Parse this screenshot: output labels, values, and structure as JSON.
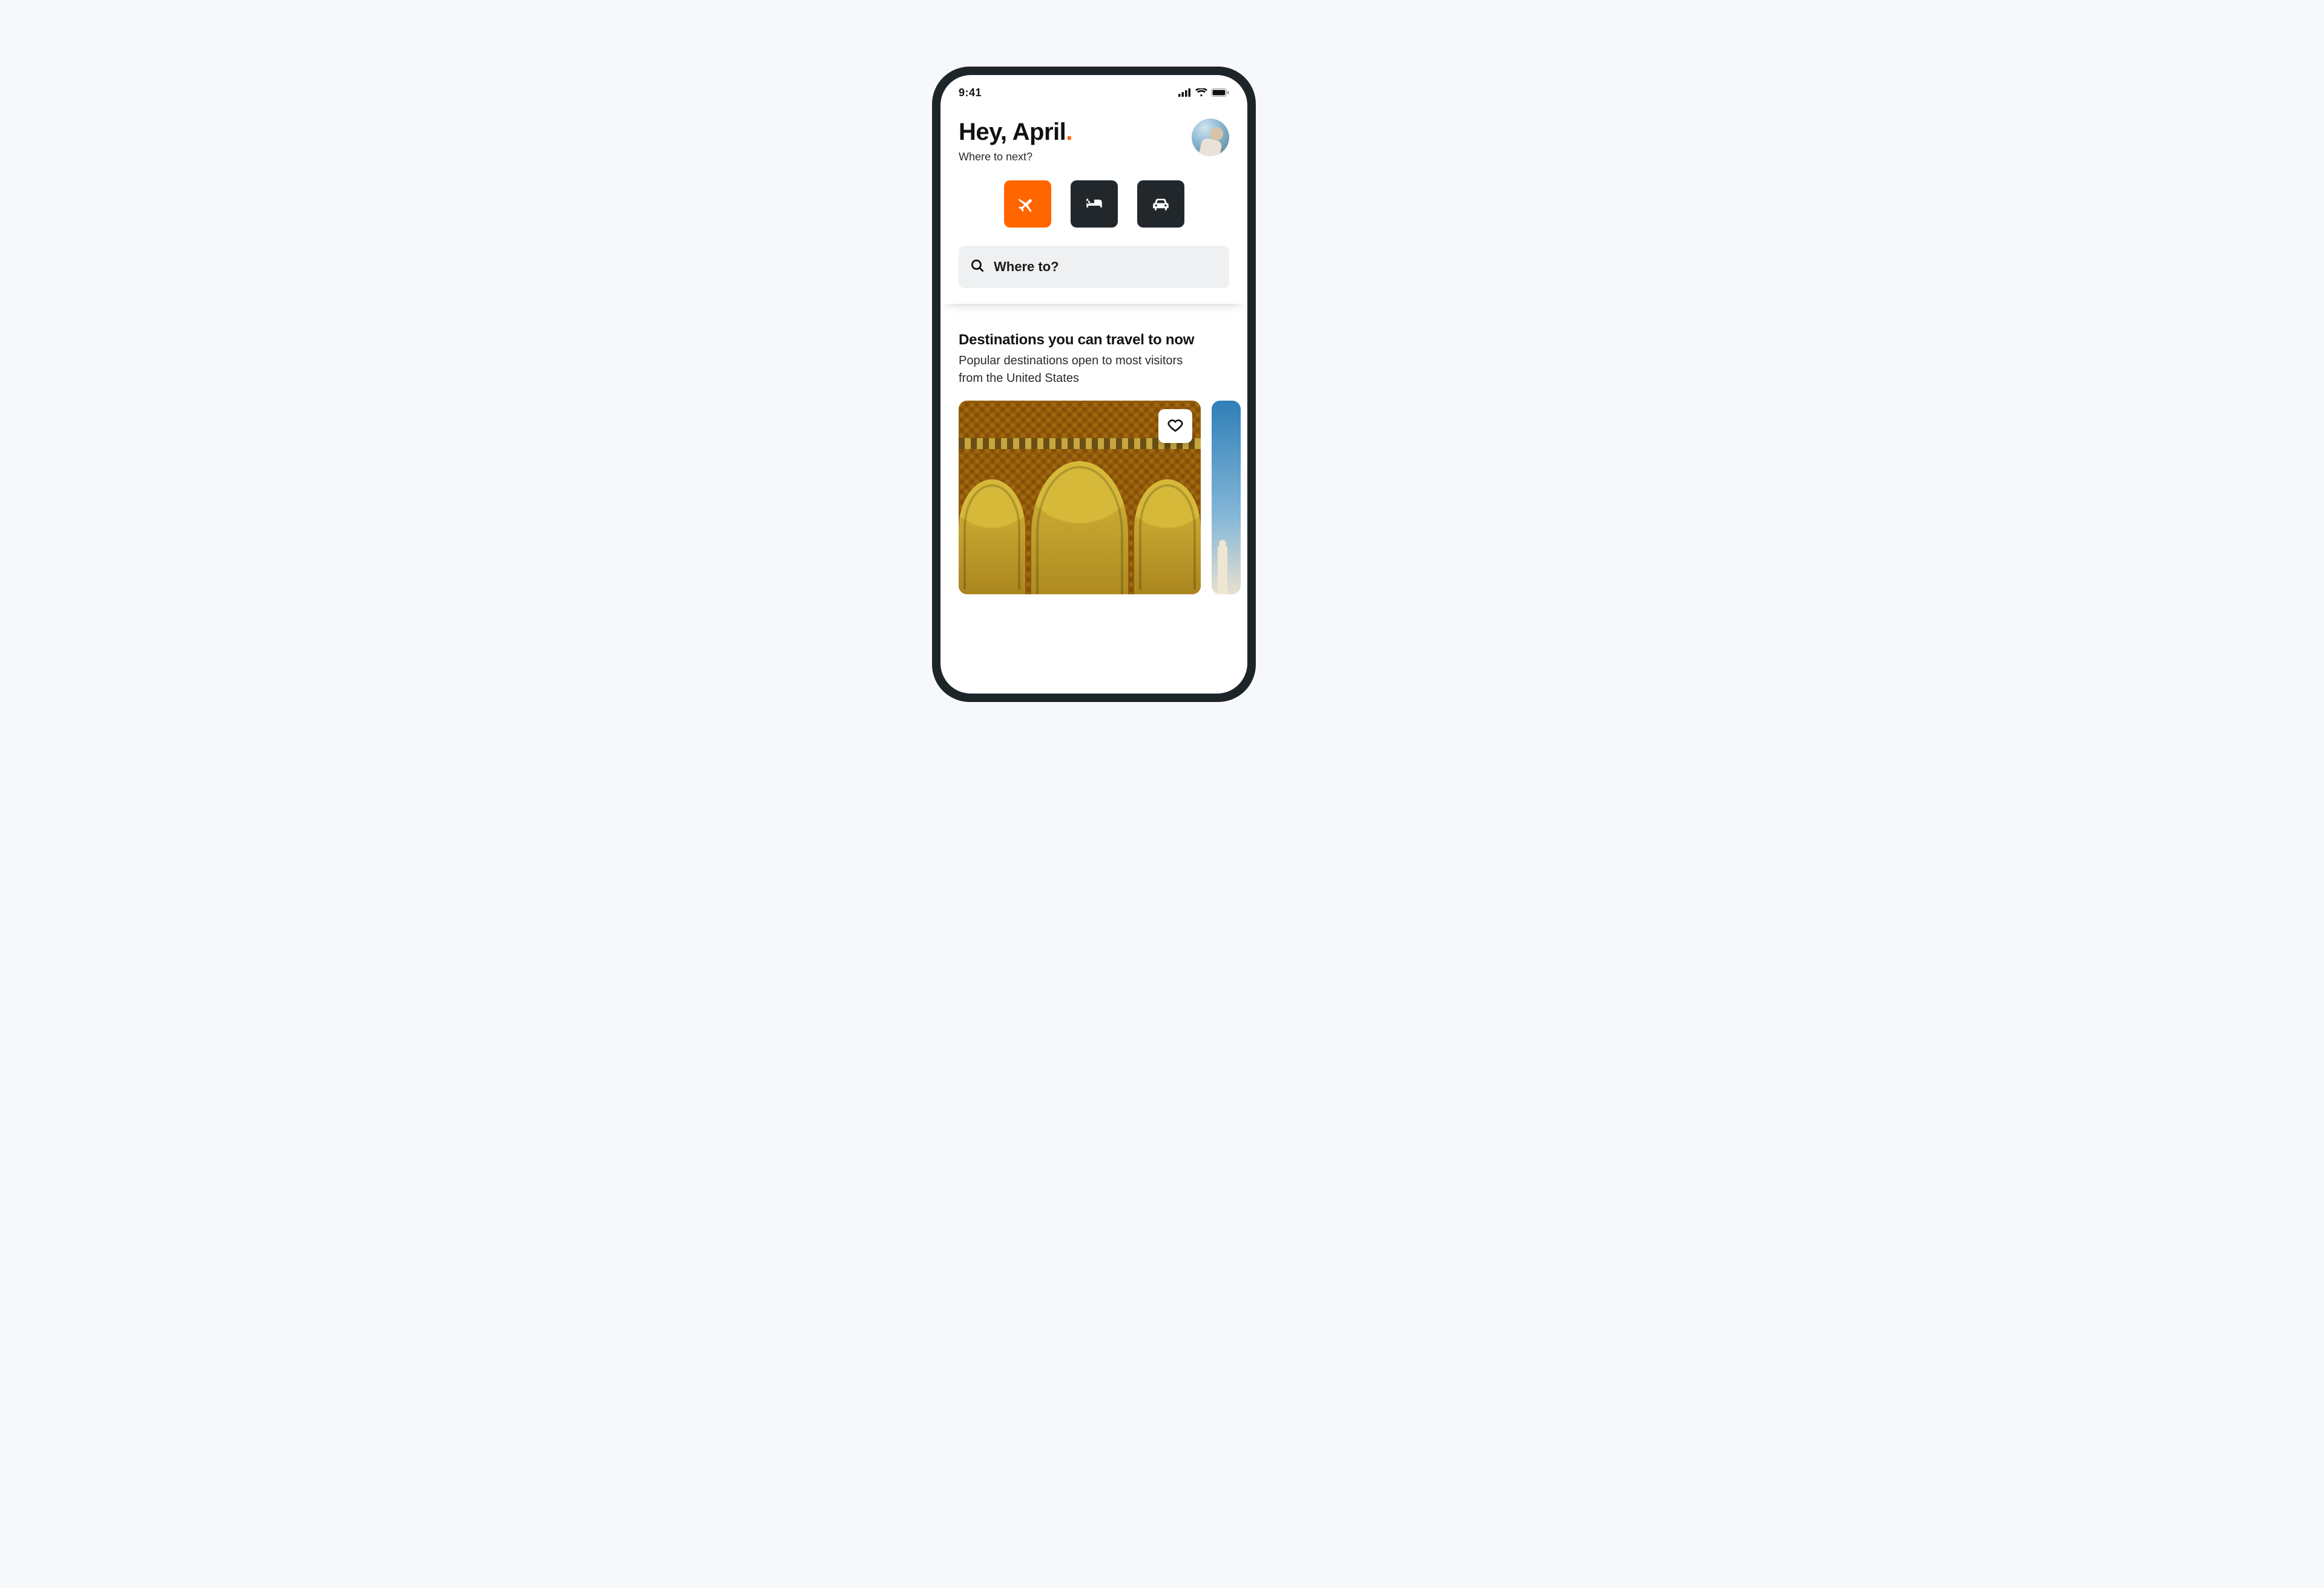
{
  "status": {
    "time": "9:41"
  },
  "header": {
    "greeting_prefix": "Hey, ",
    "greeting_name": "April",
    "greeting_suffix": ".",
    "subtitle": "Where to next?"
  },
  "categories": {
    "flights": {
      "name": "flights",
      "active": true
    },
    "hotels": {
      "name": "hotels",
      "active": false
    },
    "cars": {
      "name": "cars",
      "active": false
    }
  },
  "search": {
    "placeholder": "Where to?"
  },
  "destinations": {
    "title": "Destinations you can travel to now",
    "subtitle": "Popular destinations open to most visitors from the United States"
  },
  "colors": {
    "accent": "#ff6600",
    "dark": "#22272b"
  }
}
